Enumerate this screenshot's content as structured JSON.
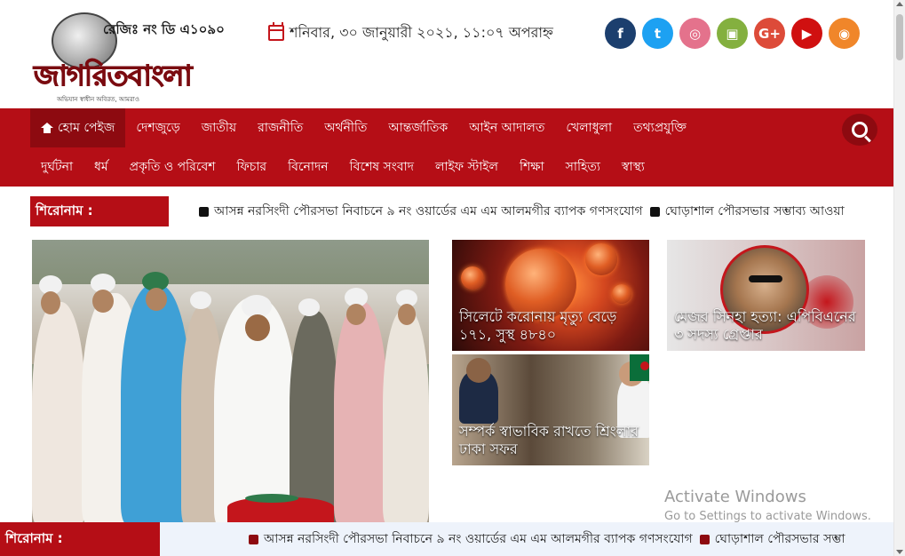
{
  "header": {
    "reg_text": "রেজিঃ নং ডি এ১০৯০",
    "brand": "জাগরিতবাংলা",
    "tagline": "অভিযান স্বাধীন অবিরত, আমরাও",
    "date_text": "শনিবার, ৩০ জানুয়ারী ২০২১, ১১:০৭ অপরাহ্ন",
    "social": [
      {
        "name": "facebook-icon",
        "glyph": "f",
        "color": "#1c3f6e"
      },
      {
        "name": "twitter-icon",
        "glyph": "t",
        "color": "#1da1f2"
      },
      {
        "name": "instagram-icon",
        "glyph": "◎",
        "color": "#e4728c"
      },
      {
        "name": "android-icon",
        "glyph": "▣",
        "color": "#84b03f"
      },
      {
        "name": "google-plus-icon",
        "glyph": "G+",
        "color": "#dd4b39"
      },
      {
        "name": "youtube-icon",
        "glyph": "▶",
        "color": "#d01010"
      },
      {
        "name": "rss-icon",
        "glyph": "◉",
        "color": "#f0862a"
      }
    ]
  },
  "nav": {
    "row1": [
      "হোম পেইজ",
      "দেশজুড়ে",
      "জাতীয়",
      "রাজনীতি",
      "অর্থনীতি",
      "আন্তর্জাতিক",
      "আইন আদালত",
      "খেলাধুলা",
      "তথ্যপ্রযুক্তি"
    ],
    "row2": [
      "দুর্ঘটনা",
      "ধর্ম",
      "প্রকৃতি ও পরিবেশ",
      "ফিচার",
      "বিনোদন",
      "বিশেষ সংবাদ",
      "লাইফ স্টাইল",
      "শিক্ষা",
      "সাহিত্য",
      "স্বাস্থ্য"
    ]
  },
  "ticker": {
    "label": "শিরোনাম :",
    "items": [
      "আসন্ন নরসিংদী পৌরসভা নিবাচনে ৯ নং ওয়ার্ডের এম এম আলমগীর ব্যাপক গণসংযোগ",
      "ঘোড়াশাল পৌরসভার সম্ভাব্য আওয়া"
    ]
  },
  "tiles": [
    {
      "caption": "সিলেটে করোনায় মৃত্যু বেড়ে ১৭১, সুস্থ ৪৮৪০"
    },
    {
      "caption": "মেজর সিনহা হত্যা: এপিবিএনের ৩ সদস্য গ্রেপ্তার"
    },
    {
      "caption": "সম্পর্ক স্বাভাবিক রাখতে শ্রিংলার ঢাকা সফর"
    }
  ],
  "sticky": {
    "label": "শিরোনাম :",
    "items": [
      "আসন্ন নরসিংদী পৌরসভা নিবাচনে ৯ নং ওয়ার্ডের এম এম আলমগীর ব্যাপক গণসংযোগ",
      "ঘোড়াশাল পৌরসভার সম্ভা"
    ]
  },
  "watermark": {
    "line1": "Activate Windows",
    "line2": "Go to Settings to activate Windows."
  }
}
